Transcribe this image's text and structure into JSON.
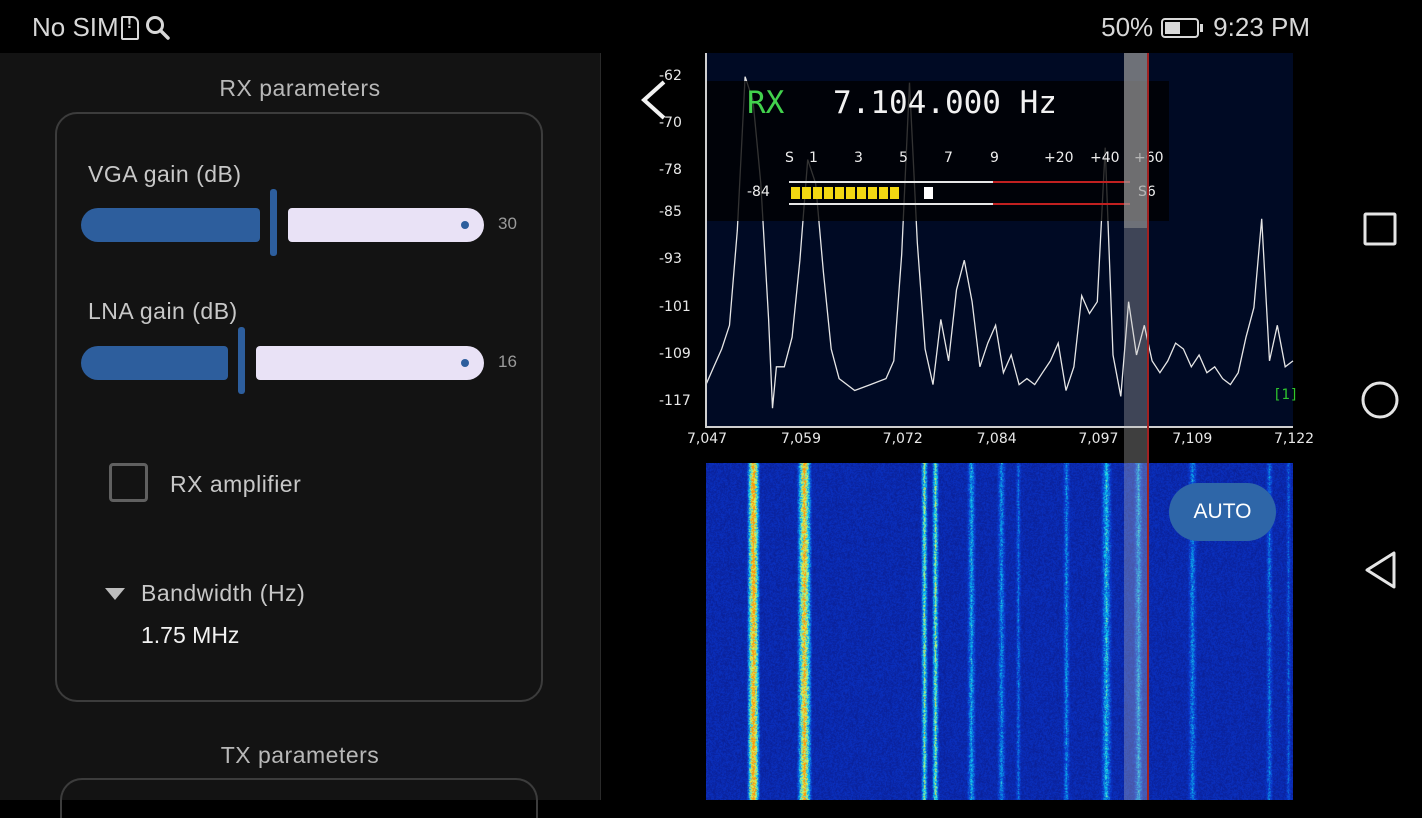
{
  "status_bar": {
    "carrier": "No SIM",
    "battery_percent": "50%",
    "battery_level": 0.5,
    "time": "9:23 PM"
  },
  "left_panel": {
    "rx_title": "RX parameters",
    "vga_gain": {
      "label": "VGA gain (dB)",
      "value_text": "30",
      "fraction": 0.48
    },
    "lna_gain": {
      "label": "LNA gain (dB)",
      "value_text": "16",
      "fraction": 0.4
    },
    "rx_amplifier": {
      "label": "RX amplifier",
      "checked": false
    },
    "bandwidth": {
      "label": "Bandwidth (Hz)",
      "value": "1.75 MHz"
    },
    "tx_title": "TX parameters"
  },
  "receiver": {
    "mode": "RX",
    "frequency": "7.104.000 Hz",
    "s_meter": {
      "scale_labels": [
        "S",
        "1",
        "3",
        "5",
        "7",
        "9",
        "+20",
        "+40",
        "+60"
      ],
      "level_value": "-84",
      "reading": "S6",
      "segments_lit": 10
    },
    "channel_tag": "[1]",
    "auto_button": "AUTO"
  },
  "chart_data": {
    "type": "line",
    "title": "",
    "xlabel": "",
    "ylabel": "",
    "x_ticks": [
      "7,047",
      "7,059",
      "7,072",
      "7,084",
      "7,097",
      "7,109",
      "7,122"
    ],
    "y_ticks": [
      "-62",
      "-70",
      "-78",
      "-85",
      "-93",
      "-101",
      "-109",
      "-117"
    ],
    "xlim": [
      7047,
      7122
    ],
    "ylim": [
      -121,
      -58
    ],
    "series": [
      {
        "x": [
          7047,
          7048,
          7049,
          7050,
          7051,
          7052,
          7053,
          7054,
          7055,
          7055.5,
          7056,
          7057,
          7058,
          7059,
          7060,
          7061,
          7062,
          7063,
          7064,
          7066,
          7068,
          7070,
          7071,
          7072,
          7073,
          7074,
          7075,
          7076,
          7077,
          7078,
          7079,
          7080,
          7081,
          7082,
          7083,
          7084,
          7085,
          7086,
          7087,
          7088,
          7089,
          7090,
          7091,
          7092,
          7093,
          7094,
          7095,
          7096,
          7097,
          7098,
          7099,
          7100,
          7101,
          7102,
          7103,
          7104,
          7105,
          7106,
          7107,
          7108,
          7109,
          7110,
          7111,
          7112,
          7113,
          7114,
          7115,
          7116,
          7117,
          7118,
          7119,
          7120,
          7121,
          7122
        ],
        "y": [
          -114,
          -111,
          -108,
          -104,
          -88,
          -62,
          -66,
          -80,
          -103,
          -118,
          -111,
          -111,
          -106,
          -93,
          -76,
          -80,
          -95,
          -108,
          -113,
          -115,
          -114,
          -113,
          -110,
          -92,
          -63,
          -90,
          -108,
          -114,
          -103,
          -110,
          -98,
          -93,
          -100,
          -111,
          -107,
          -104,
          -112,
          -109,
          -114,
          -113,
          -114,
          -112,
          -110,
          -107,
          -115,
          -111,
          -99,
          -102,
          -100,
          -74,
          -109,
          -116,
          -100,
          -109,
          -104,
          -110,
          -112,
          -110,
          -107,
          -108,
          -111,
          -109,
          -112,
          -111,
          -113,
          -114,
          -112,
          -106,
          -101,
          -86,
          -110,
          -104,
          -111,
          -110
        ]
      }
    ]
  }
}
